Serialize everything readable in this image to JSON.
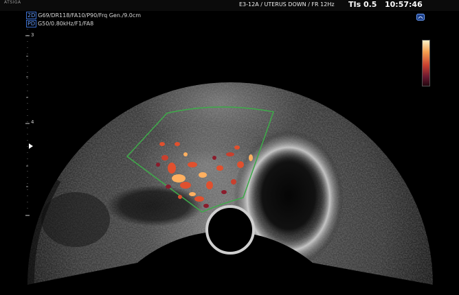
{
  "header": {
    "brand": "ATSIGA",
    "probe_info": "E3-12A / UTERUS DOWN / FR 12Hz",
    "tis": "TIs 0.5",
    "time": "10:57:46"
  },
  "mode_lines": [
    {
      "badge": "2D",
      "text": "G69/DR118/FA10/P90/Frq Gen./9.0cm"
    },
    {
      "badge": "PD",
      "text": "G50/0.80kHz/F1/FA8"
    }
  ],
  "depth_labels": [
    "3",
    "4"
  ],
  "icons": {
    "probe": "probe-orientation-icon",
    "focus": "focus-marker-icon"
  },
  "colors": {
    "roi_box": "#3fa84a",
    "doppler_hot": "#ffb060",
    "doppler_mid": "#e0502e",
    "doppler_low": "#8a1c2c",
    "text_blue": "#4f8cff"
  },
  "color_bar": {
    "top": "#fff3c8",
    "bottom": "#240810"
  }
}
